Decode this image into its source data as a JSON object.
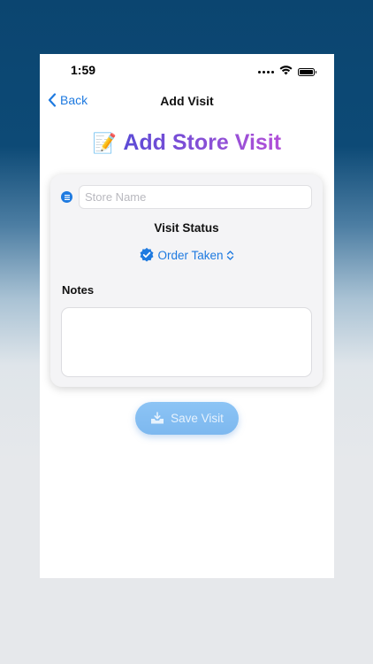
{
  "status_bar": {
    "time": "1:59"
  },
  "nav": {
    "back_label": "Back",
    "title": "Add Visit"
  },
  "page": {
    "emoji": "📝",
    "title": "Add Store Visit"
  },
  "form": {
    "store_name": {
      "value": "",
      "placeholder": "Store Name"
    },
    "visit_status_label": "Visit Status",
    "visit_status_value": "Order Taken",
    "notes_label": "Notes",
    "notes_value": ""
  },
  "save_button": {
    "label": "Save Visit"
  },
  "colors": {
    "accent": "#1e7ae0",
    "title_gradient_start": "#5b4bd6",
    "title_gradient_end": "#b24fd8",
    "save_button": "#85bef2"
  },
  "icons": [
    "chevron-left-icon",
    "wifi-icon",
    "battery-icon",
    "store-icon",
    "checkmark-seal-icon",
    "chevron-up-down-icon",
    "tray-arrow-down-icon"
  ]
}
